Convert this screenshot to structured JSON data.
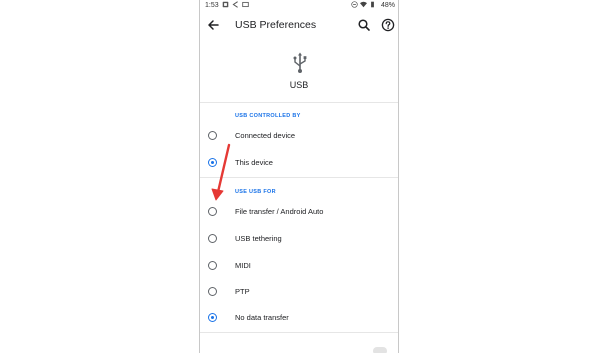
{
  "status_bar": {
    "time": "1:53",
    "battery": "48%"
  },
  "app_bar": {
    "title": "USB Preferences"
  },
  "hero": {
    "label": "USB"
  },
  "sections": {
    "controlled_by": {
      "header": "USB CONTROLLED BY",
      "options": [
        {
          "label": "Connected device",
          "checked": false
        },
        {
          "label": "This device",
          "checked": true
        }
      ]
    },
    "use_for": {
      "header": "USE USB FOR",
      "options": [
        {
          "label": "File transfer / Android Auto",
          "checked": false
        },
        {
          "label": "USB tethering",
          "checked": false
        },
        {
          "label": "MIDI",
          "checked": false
        },
        {
          "label": "PTP",
          "checked": false
        },
        {
          "label": "No data transfer",
          "checked": true
        }
      ]
    }
  },
  "colors": {
    "accent": "#1a73e8",
    "annotation_arrow": "#e53935"
  },
  "icons": [
    "back-arrow-icon",
    "search-icon",
    "help-icon",
    "usb-icon"
  ]
}
